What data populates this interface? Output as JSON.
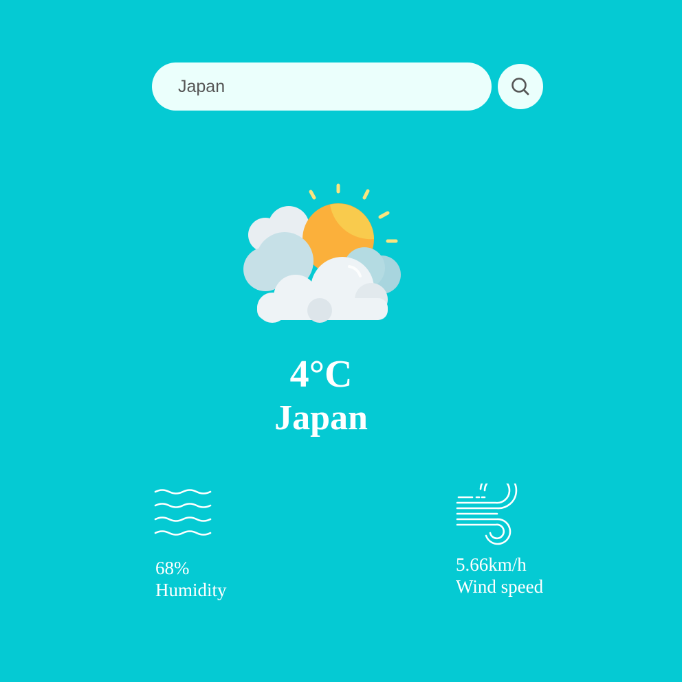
{
  "search": {
    "value": "Japan",
    "placeholder": "",
    "button_icon": "search-icon"
  },
  "weather": {
    "icon": "partly-cloudy-icon",
    "temperature": "4°C",
    "city": "Japan"
  },
  "details": {
    "humidity": {
      "icon": "humidity-waves-icon",
      "value": "68%",
      "label": "Humidity"
    },
    "wind": {
      "icon": "wind-icon",
      "value": "5.66km/h",
      "label": "Wind speed"
    }
  },
  "colors": {
    "background": "#05cad3",
    "search_field": "#ebfffc",
    "text": "#ffffff",
    "sun": "#fbb03b",
    "cloud": "#eef3f6"
  }
}
